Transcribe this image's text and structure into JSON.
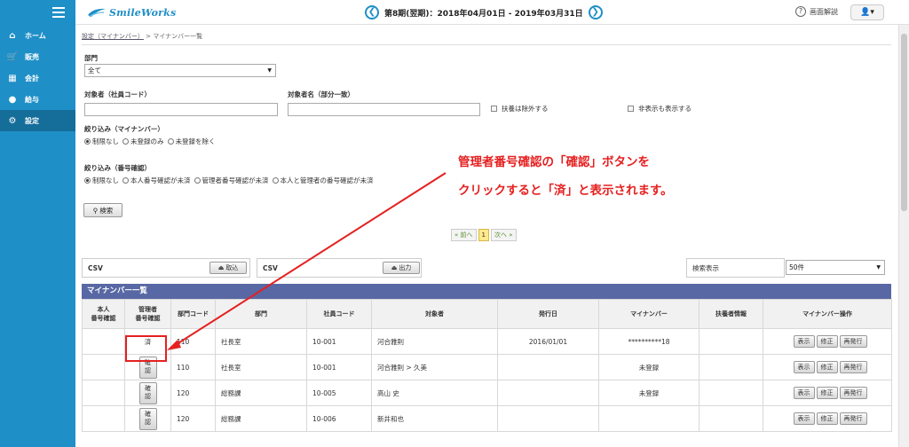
{
  "app": {
    "logo_text": "SmileWorks"
  },
  "header": {
    "period_text": "第8期(翌期)：2018年04月01日 - 2019年03月31日",
    "prev_glyph": "❮",
    "next_glyph": "❯",
    "help_label": "画面解説",
    "user_glyph": "👤▾"
  },
  "sidebar": {
    "items": [
      {
        "label": "ホーム",
        "icon": "home-icon",
        "glyph": "⌂"
      },
      {
        "label": "販売",
        "icon": "cart-icon",
        "glyph": "🛒"
      },
      {
        "label": "会計",
        "icon": "ledger-icon",
        "glyph": "▦"
      },
      {
        "label": "給与",
        "icon": "money-bag-icon",
        "glyph": "●"
      },
      {
        "label": "設定",
        "icon": "gear-icon",
        "glyph": "⚙"
      }
    ],
    "active_index": 4
  },
  "breadcrumb": {
    "parent": "設定（マイナンバー）",
    "separator": ">",
    "current": "マイナンバー一覧"
  },
  "filters": {
    "department_label": "部門",
    "department_value": "全て",
    "employee_code_label": "対象者（社員コード）",
    "employee_name_label": "対象者名（部分一致）",
    "exclude_dependents_label": "扶養は除外する",
    "show_hidden_label": "非表示も表示する",
    "mynumber_filter_label": "絞り込み（マイナンバー）",
    "mynumber_options": [
      "制限なし",
      "未登録のみ",
      "未登録を除く"
    ],
    "number_check_filter_label": "絞り込み（番号確認）",
    "number_check_options": [
      "制限なし",
      "本人番号確認が未済",
      "管理者番号確認が未済",
      "本人と管理者の番号確認が未済"
    ],
    "search_button": "検索"
  },
  "pager": {
    "prev": "« 前へ",
    "current": "1",
    "next": "次へ »"
  },
  "csv_import": {
    "label": "CSV",
    "button": "取込"
  },
  "csv_export": {
    "label": "CSV",
    "button": "出力"
  },
  "display_count": {
    "label": "検索表示",
    "value": "50件"
  },
  "list": {
    "title": "マイナンバー一覧",
    "headers": [
      "本人\n番号確認",
      "管理者\n番号確認",
      "部門コード",
      "部門",
      "社員コード",
      "対象者",
      "発行日",
      "マイナンバー",
      "扶養者情報",
      "マイナンバー操作"
    ],
    "done_label": "済",
    "confirm_label": "確\n認",
    "ops": [
      "表示",
      "修正",
      "再発行"
    ],
    "rows": [
      {
        "self_check": "",
        "admin_status": "done",
        "dept_code": "110",
        "dept": "社長室",
        "emp_code": "10-001",
        "name": "河合雅則",
        "issued": "2016/01/01",
        "mynumber": "**********18",
        "mynumber_registered": true,
        "dependent": ""
      },
      {
        "self_check": "",
        "admin_status": "pending",
        "dept_code": "110",
        "dept": "社長室",
        "emp_code": "10-001",
        "name": "河合雅則 > 久美",
        "issued": "",
        "mynumber": "未登録",
        "mynumber_registered": false,
        "dependent": ""
      },
      {
        "self_check": "",
        "admin_status": "pending",
        "dept_code": "120",
        "dept": "総務課",
        "emp_code": "10-005",
        "name": "高山 史",
        "issued": "",
        "mynumber": "未登録",
        "mynumber_registered": false,
        "dependent": ""
      },
      {
        "self_check": "",
        "admin_status": "pending",
        "dept_code": "120",
        "dept": "総務課",
        "emp_code": "10-006",
        "name": "新井和也",
        "issued": "",
        "mynumber": "",
        "mynumber_registered": false,
        "dependent": ""
      }
    ]
  },
  "annotation": {
    "line1": "管理者番号確認の「確認」ボタンを",
    "line2": "クリックすると「済」と表示されます。"
  },
  "colors": {
    "sidebar": "#1f8fc7",
    "section_header": "#5868a4",
    "annotation": "#e52020"
  }
}
